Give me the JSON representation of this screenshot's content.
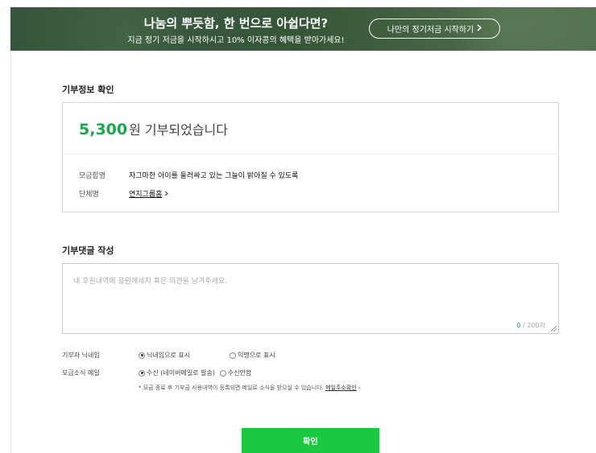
{
  "banner": {
    "title": "나눔의 뿌듯함, 한 번으로 아쉽다면?",
    "subtitle": "지금 정기 저금을 시작하시고 10% 이자콩의 혜택을 받아가세요!",
    "button_label": "나만의 정기저금 시작하기",
    "button_icon": "chevron-right-icon"
  },
  "donation_info": {
    "section_title": "기부정보 확인",
    "amount": "5,300",
    "amount_suffix": "원 기부되었습니다",
    "campaign_label": "모금함명",
    "campaign_value": "자그마한 아이를 둘러싸고 있는 그늘이 밝아질 수 있도록",
    "org_label": "단체명",
    "org_value": "연지그룹홈",
    "org_link_icon": "arrow-link-icon"
  },
  "comment": {
    "section_title": "기부댓글 작성",
    "placeholder": "내 후원내역에 응원메세지 혹은 의견을 남겨주세요.",
    "count_current": "0",
    "count_max": "/ 200자"
  },
  "options": {
    "nickname_label": "기부자 닉네임",
    "nickname_opt1": "닉네임으로 표시",
    "nickname_opt2": "익명으로 표시",
    "mail_label": "모금소식 메일",
    "mail_opt1": "수신 (네이버메일로 발송)",
    "mail_opt2": "수신안함",
    "note_text": "* 모금 종료 후 기부금 사용내역이 등록되면 메일로 소식을 받으실 수 있습니다.",
    "note_link": "메일주소확인"
  },
  "confirm_label": "확인",
  "colors": {
    "accent_green": "#18a84a",
    "button_green": "#19c93f"
  }
}
